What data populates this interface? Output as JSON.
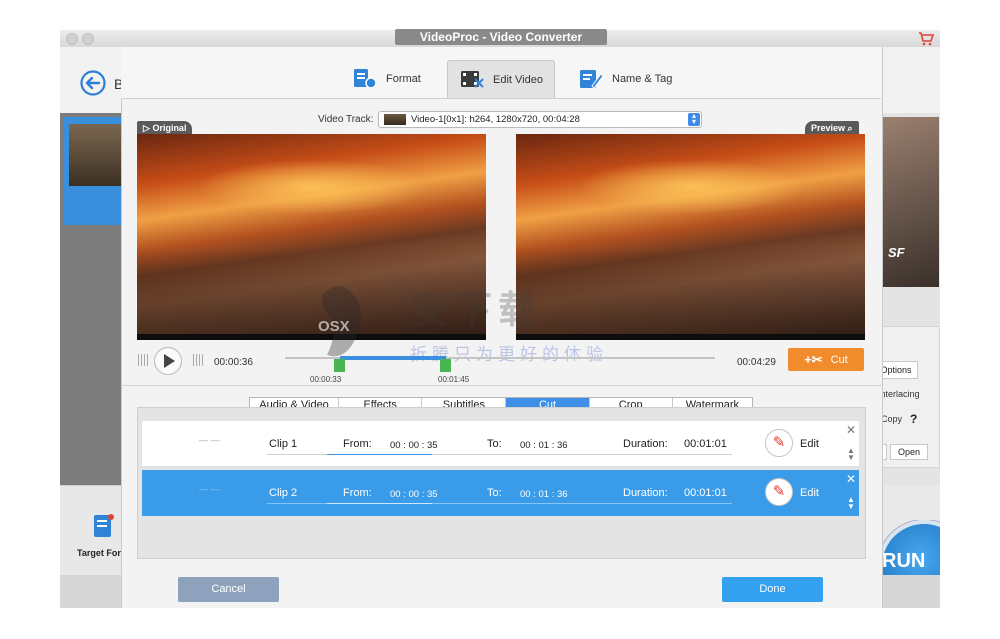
{
  "window": {
    "title": "VideoProc - Video Converter",
    "back_label": "B",
    "target_format_label": "Target Format",
    "run_label": "RUN",
    "right_options_label": "Options",
    "right_interlace_label": "Interlacing",
    "right_copy_label": "Copy",
    "right_help": "?",
    "right_open_label": "Open",
    "right_thumb_text": "SF"
  },
  "tabs": [
    {
      "label": "Format",
      "icon": "format-icon"
    },
    {
      "label": "Edit Video",
      "icon": "edit-video-icon",
      "active": true
    },
    {
      "label": "Name & Tag",
      "icon": "name-tag-icon"
    }
  ],
  "video_track": {
    "label": "Video Track:",
    "value": "Video-1[0x1]: h264, 1280x720, 00:04:28"
  },
  "preview": {
    "original_badge": "Original",
    "preview_badge": "Preview",
    "original_badge_icon": "play-triangle-icon",
    "preview_badge_icon": "magnifier-icon"
  },
  "playback": {
    "current_time": "00:00:36",
    "end_time": "00:04:29",
    "sel_start": "00:00:33",
    "sel_end": "00:01:45",
    "cut_label": "Cut"
  },
  "subtabs": [
    {
      "label": "Audio & Video"
    },
    {
      "label": "Effects"
    },
    {
      "label": "Subtitles"
    },
    {
      "label": "Cut",
      "active": true
    },
    {
      "label": "Crop"
    },
    {
      "label": "Watermark"
    }
  ],
  "clips": [
    {
      "name": "Clip 1",
      "from_label": "From:",
      "from": "00 : 00 : 35",
      "to_label": "To:",
      "to": "00 : 01 : 36",
      "duration_label": "Duration:",
      "duration": "00:01:01",
      "edit_label": "Edit",
      "selected": false
    },
    {
      "name": "Clip 2",
      "from_label": "From:",
      "from": "00 : 00 : 35",
      "to_label": "To:",
      "to": "00 : 01 : 36",
      "duration_label": "Duration:",
      "duration": "00:01:01",
      "edit_label": "Edit",
      "selected": true
    }
  ],
  "buttons": {
    "cancel": "Cancel",
    "done": "Done"
  },
  "watermark": {
    "text": "安下载",
    "subtext": "折腾只为更好的体验",
    "logo": "OSX"
  },
  "colors": {
    "accent": "#3a9ce8",
    "cut_orange": "#f18c2c",
    "handle_green": "#49b653",
    "cancel_grey_blue": "#8fa2bd"
  }
}
